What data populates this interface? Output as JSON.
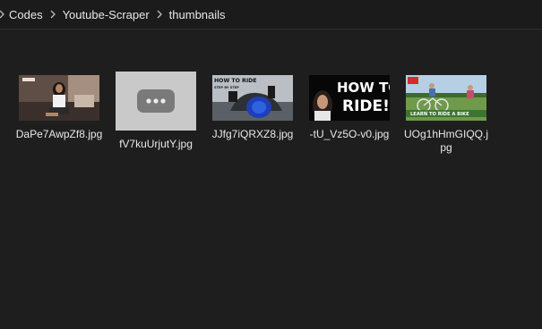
{
  "breadcrumb": {
    "items": [
      "Codes",
      "Youtube-Scraper",
      "thumbnails"
    ]
  },
  "files": [
    {
      "name": "DaPe7AwpZf8.jpg",
      "icon": "photo-thumbnail-woman-sitting"
    },
    {
      "name": "fV7kuUrjutY.jpg",
      "icon": "placeholder-dots-icon"
    },
    {
      "name": "JJfg7iQRXZ8.jpg",
      "icon": "photo-thumbnail-motorcycle",
      "caption_lines": [
        "HOW TO RIDE",
        "STEP BY STEP"
      ]
    },
    {
      "name": "-tU_Vz5O-v0.jpg",
      "icon": "photo-thumbnail-how-to-ride",
      "caption_lines": [
        "HOW TO",
        "RIDE!"
      ]
    },
    {
      "name": "UOg1hHmGIQQ.jpg",
      "icon": "photo-thumbnail-bike",
      "caption_lines": [
        "LEARN TO RIDE A BIKE"
      ]
    }
  ],
  "colors": {
    "background": "#1e1e1e",
    "bar": "#1b1b1b",
    "text": "#e8e8e8"
  }
}
